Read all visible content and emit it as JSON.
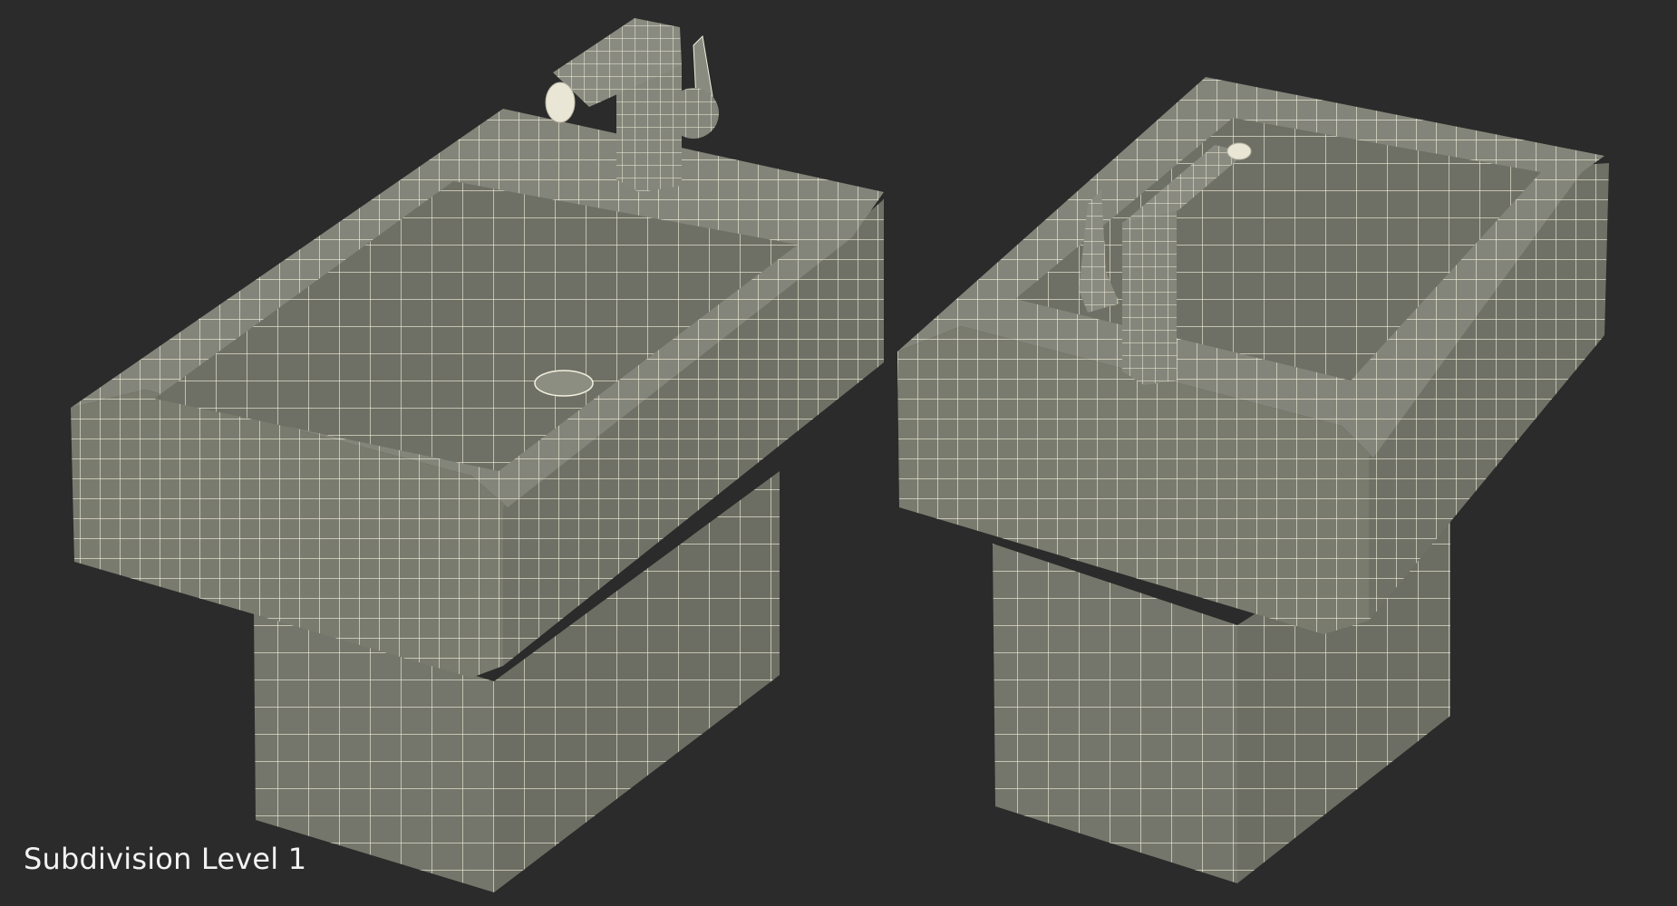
{
  "scene": {
    "background": "#2b2b2b",
    "surface_color": "#7e7e72",
    "surface_dark": "#6e6f64",
    "surface_light": "#8a8a7e",
    "wire_color": "#f4f1de",
    "caption": "Subdivision Level 1"
  }
}
